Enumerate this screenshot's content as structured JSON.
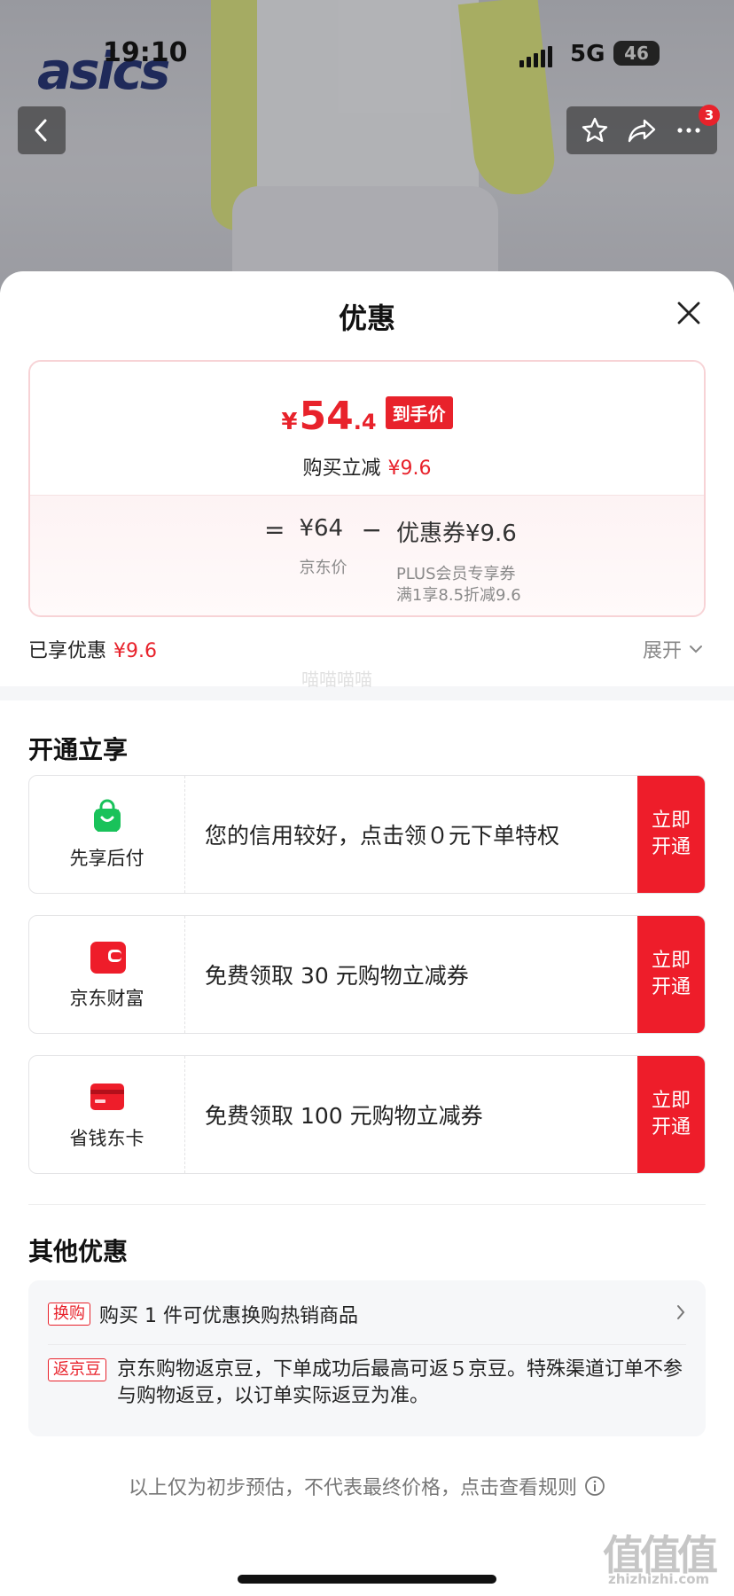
{
  "status_bar": {
    "time": "19:10",
    "network": "5G",
    "battery": "46"
  },
  "hero": {
    "brand_logo": "asics",
    "cart_badge": "3"
  },
  "nav": {
    "back_icon": "chevron-left-icon",
    "actions": [
      "star-icon",
      "share-icon",
      "more-icon"
    ]
  },
  "sheet": {
    "title": "优惠",
    "price": {
      "currency": "¥",
      "integer": "54",
      "decimal": ".4",
      "tag": "到手价",
      "reduce_label": "购买立减",
      "reduce_amount": "¥9.6"
    },
    "formula": {
      "eq": "=",
      "base_price": "¥64",
      "base_label": "京东价",
      "minus": "−",
      "coupon": "优惠券¥9.6",
      "coupon_desc_1": "PLUS会员专享券",
      "coupon_desc_2": "满1享8.5折减9.6"
    },
    "enjoyed_label": "已享优惠",
    "enjoyed_amount": "¥9.6",
    "expand_label": "展开",
    "watermark": "喵喵喵喵"
  },
  "open_section": {
    "title": "开通立享",
    "items": [
      {
        "label": "先享后付",
        "icon": "shopping-bag-icon",
        "desc": "您的信用较好，点击领０元下单特权",
        "button": "立即开通"
      },
      {
        "label": "京东财富",
        "icon": "wallet-icon",
        "desc": "免费领取 30 元购物立减券",
        "button": "立即开通"
      },
      {
        "label": "省钱东卡",
        "icon": "card-icon",
        "desc": "免费领取 100 元购物立减券",
        "button": "立即开通"
      }
    ]
  },
  "other_section": {
    "title": "其他优惠",
    "rows": [
      {
        "tag": "换购",
        "text": "购买 1 件可优惠换购热销商品"
      },
      {
        "tag": "返京豆",
        "text": "京东购物返京豆，下单成功后最高可返５京豆。特殊渠道订单不参与购物返豆，以订单实际返豆为准。"
      }
    ]
  },
  "footer": {
    "note": "以上仅为初步预估，不代表最终价格，点击查看规则",
    "watermark": "值值值",
    "watermark_url": "zhizhizhi.com"
  },
  "colors": {
    "accent": "#e8222b",
    "button": "#ee1d2a",
    "green": "#19c25a"
  }
}
